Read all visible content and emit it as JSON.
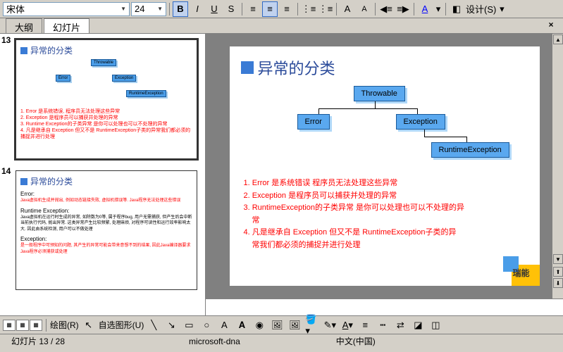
{
  "toolbar": {
    "font": "宋体",
    "size": "24",
    "bold": "B",
    "italic": "I",
    "underline": "U",
    "strike": "S",
    "design": "设计(S)"
  },
  "tabs": {
    "outline": "大纲",
    "slides": "幻灯片"
  },
  "thumbs": {
    "n13": "13",
    "n14": "14",
    "title": "异常的分类",
    "t13_lines": [
      "1. Error 是系统错误, 程序员无法处理这些异常",
      "2. Exception 是程序员可以捕获并处理的异常",
      "3. Runtime Exception的子类异常 是你可以处理也可以不处理的异常",
      "4. 凡是继承自 Exception 但又不是 RuntimeException子类的异常我们都必须的捕捉并进行处理"
    ],
    "t14_h1": "Error:",
    "t14_h2": "Runtime Exception:",
    "t14_h3": "Exception:"
  },
  "slide": {
    "title": "异常的分类",
    "box_throwable": "Throwable",
    "box_error": "Error",
    "box_exception": "Exception",
    "box_runtime": "RuntimeException",
    "b1": "1. Error 是系统错误  程序员无法处理这些异常",
    "b2": "2. Exception 是程序员可以捕获并处理的异常",
    "b3": "3. RuntimeException的子类异常 是你可以处理也可以不处理的异",
    "b3b": "常",
    "b4": "4. 凡是继承自 Exception 但又不是 RuntimeException子类的异",
    "b4b": "常我们都必须的捕捉并进行处理",
    "logo": "瑞能"
  },
  "draw": {
    "menu": "绘图(R)",
    "autoshape": "自选图形(U)"
  },
  "status": {
    "slide": "幻灯片 13 / 28",
    "template": "microsoft-dna",
    "lang": "中文(中国)"
  }
}
